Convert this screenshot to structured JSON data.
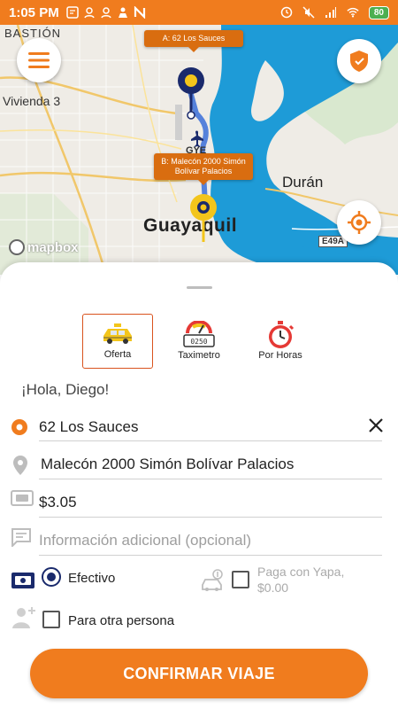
{
  "status_bar": {
    "time": "1:05 PM",
    "battery": "80"
  },
  "map": {
    "labels": {
      "bastion": "BASTIÓN",
      "vivienda": "Vivienda 3",
      "guayaquil": "Guayaquil",
      "duran": "Durán",
      "gye": "GYE",
      "road": "E49A"
    },
    "marker_a": "A: 62 Los Sauces",
    "marker_b_line1": "B: Malecón 2000 Simón",
    "marker_b_line2": "Bolívar Palacios",
    "attribution": "mapbox"
  },
  "modes": [
    {
      "label": "Oferta",
      "selected": true
    },
    {
      "label": "Taximetro",
      "selected": false
    },
    {
      "label": "Por Horas",
      "selected": false
    }
  ],
  "taximeter_display": "0250",
  "greeting": "¡Hola, Diego!",
  "form": {
    "origin": "62 Los Sauces",
    "destination": "Malecón 2000 Simón Bolívar Palacios",
    "price": "$3.05",
    "info_placeholder": "Información adicional (opcional)"
  },
  "payment": {
    "cash_label": "Efectivo",
    "cash_selected": true,
    "yapa_line1": "Paga con Yapa,",
    "yapa_line2": "$0.00",
    "yapa_checked": false
  },
  "other_person": {
    "label": "Para otra persona",
    "checked": false
  },
  "confirm_label": "CONFIRMAR VIAJE",
  "colors": {
    "accent": "#f07c1e",
    "navy": "#1a2a6c",
    "river": "#1e9bd7"
  }
}
